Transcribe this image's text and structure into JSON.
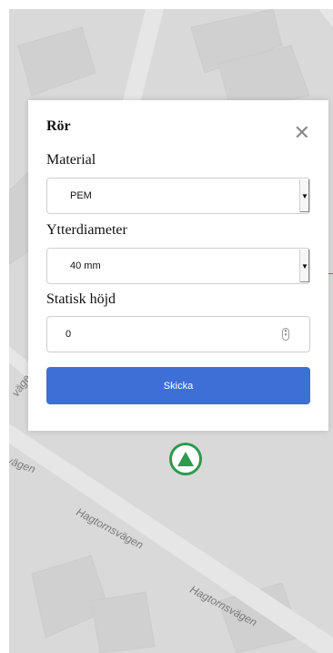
{
  "map": {
    "roads": [
      "vägen",
      "Hagtornsvägen",
      "Hagtornsvägen",
      "väge"
    ]
  },
  "marker": {
    "icon": "triangle-up-icon",
    "color": "#2e9a4e"
  },
  "modal": {
    "title": "Rör",
    "close_icon": "close-icon",
    "fields": {
      "material_label": "Material",
      "material_value": "PEM",
      "diameter_label": "Ytterdiameter",
      "diameter_value": "40 mm",
      "height_label": "Statisk höjd",
      "height_value": "0"
    },
    "submit_label": "Skicka",
    "accent": "#3e6fd6"
  }
}
